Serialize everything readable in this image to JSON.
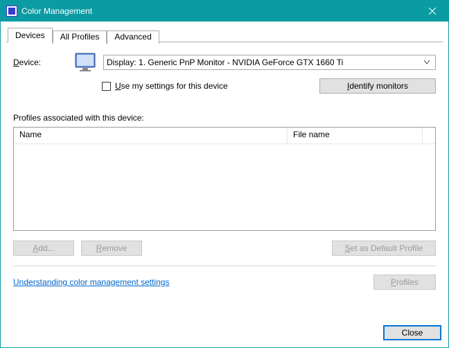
{
  "titlebar": {
    "title": "Color Management"
  },
  "tabs": {
    "devices": "Devices",
    "all_profiles": "All Profiles",
    "advanced": "Advanced"
  },
  "device": {
    "label": "Device:",
    "selected": "Display: 1. Generic PnP Monitor - NVIDIA GeForce GTX 1660 Ti"
  },
  "use_my_settings": "Use my settings for this device",
  "identify_button": "Identify monitors",
  "profiles_label": "Profiles associated with this device:",
  "columns": {
    "name": "Name",
    "file": "File name"
  },
  "buttons": {
    "add": "Add...",
    "remove": "Remove",
    "set_default": "Set as Default Profile",
    "profiles": "Profiles",
    "close": "Close"
  },
  "link": "Understanding color management settings"
}
